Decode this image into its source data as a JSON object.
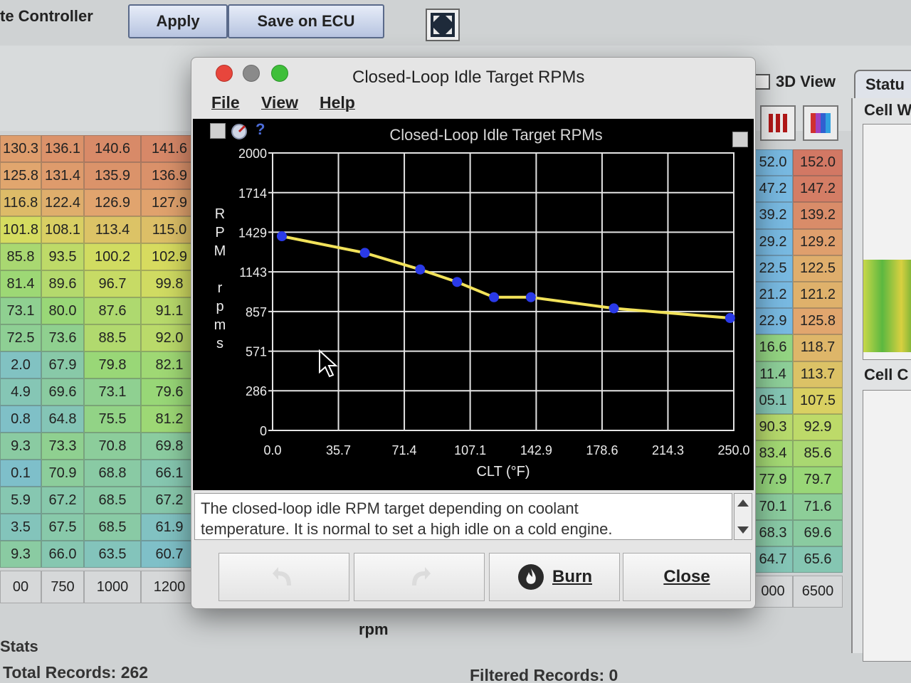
{
  "app": {
    "title_fragment": "te Controller",
    "apply_label": "Apply",
    "save_label": "Save on ECU",
    "view_3d_label": "3D View",
    "status_tab_label": "Statu",
    "cell_w_label": "Cell W",
    "cell_c_label": "Cell C",
    "rpm_axis_label": "rpm",
    "stats_label": "Stats",
    "total_records": "Total Records: 262",
    "filtered_records": "Filtered Records: 0"
  },
  "table_left": {
    "columns": [
      "",
      "750",
      "1000",
      "1200"
    ],
    "rows": [
      [
        "130.3",
        "136.1",
        "140.6",
        "141.6"
      ],
      [
        "125.8",
        "131.4",
        "135.9",
        "136.9"
      ],
      [
        "116.8",
        "122.4",
        "126.9",
        "127.9"
      ],
      [
        "101.8",
        "108.1",
        "113.4",
        "115.0"
      ],
      [
        "85.8",
        "93.5",
        "100.2",
        "102.9"
      ],
      [
        "81.4",
        "89.6",
        "96.7",
        "99.8"
      ],
      [
        "73.1",
        "80.0",
        "87.6",
        "91.1"
      ],
      [
        "72.5",
        "73.6",
        "88.5",
        "92.0"
      ],
      [
        "2.0",
        "67.9",
        "79.8",
        "82.1"
      ],
      [
        "4.9",
        "69.6",
        "73.1",
        "79.6"
      ],
      [
        "0.8",
        "64.8",
        "75.5",
        "81.2"
      ],
      [
        "9.3",
        "73.3",
        "70.8",
        "69.8"
      ],
      [
        "0.1",
        "70.9",
        "68.8",
        "66.1"
      ],
      [
        "5.9",
        "67.2",
        "68.5",
        "67.2"
      ],
      [
        "3.5",
        "67.5",
        "68.5",
        "61.9"
      ],
      [
        "9.3",
        "66.0",
        "63.5",
        "60.7"
      ]
    ],
    "footer": [
      "00",
      "750",
      "1000",
      "1200"
    ]
  },
  "table_right": {
    "rows": [
      [
        "52.0",
        "152.0"
      ],
      [
        "47.2",
        "147.2"
      ],
      [
        "39.2",
        "139.2"
      ],
      [
        "29.2",
        "129.2"
      ],
      [
        "22.5",
        "122.5"
      ],
      [
        "21.2",
        "121.2"
      ],
      [
        "22.9",
        "125.8"
      ],
      [
        "16.6",
        "118.7"
      ],
      [
        "11.4",
        "113.7"
      ],
      [
        "05.1",
        "107.5"
      ],
      [
        "90.3",
        "92.9"
      ],
      [
        "83.4",
        "85.6"
      ],
      [
        "77.9",
        "79.7"
      ],
      [
        "70.1",
        "71.6"
      ],
      [
        "68.3",
        "69.6"
      ],
      [
        "64.7",
        "65.6"
      ]
    ],
    "footer": [
      "000",
      "6500"
    ]
  },
  "dialog": {
    "title": "Closed-Loop Idle Target RPMs",
    "menu": [
      "File",
      "View",
      "Help"
    ],
    "help_text_line1": "The closed-loop idle RPM target depending on coolant",
    "help_text_line2": "temperature. It is normal to set a high idle on a cold engine.",
    "burn_label": "Burn",
    "close_label": "Close",
    "help_icon_glyph": "?"
  },
  "chart_data": {
    "type": "line",
    "title": "Closed-Loop Idle Target RPMs",
    "xlabel": "CLT (°F)",
    "ylabel": "RPM rpms",
    "ylabel_letters": [
      "R",
      "P",
      "M",
      "",
      "r",
      "p",
      "m",
      "s"
    ],
    "x_ticks": [
      "0.0",
      "35.7",
      "71.4",
      "107.1",
      "142.9",
      "178.6",
      "214.3",
      "250.0"
    ],
    "y_ticks": [
      "2000",
      "1714",
      "1429",
      "1143",
      "857",
      "571",
      "286",
      "0"
    ],
    "xlim": [
      0,
      250
    ],
    "ylim": [
      0,
      2000
    ],
    "grid": true,
    "series": [
      {
        "color": "#f2e25a",
        "point_color": "#2a3ae8",
        "points": [
          {
            "x": 5,
            "y": 1400
          },
          {
            "x": 50,
            "y": 1280
          },
          {
            "x": 80,
            "y": 1160
          },
          {
            "x": 100,
            "y": 1070
          },
          {
            "x": 120,
            "y": 960
          },
          {
            "x": 140,
            "y": 960
          },
          {
            "x": 185,
            "y": 880
          },
          {
            "x": 252,
            "y": 810
          }
        ]
      }
    ]
  }
}
